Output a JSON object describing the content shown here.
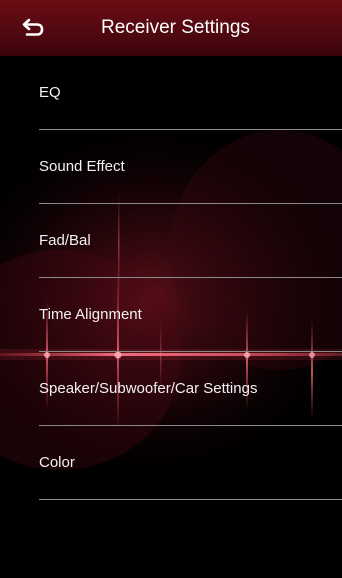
{
  "header": {
    "title": "Receiver Settings",
    "back_icon": "back-return-icon"
  },
  "menu": {
    "items": [
      {
        "label": "EQ"
      },
      {
        "label": "Sound Effect"
      },
      {
        "label": "Fad/Bal"
      },
      {
        "label": "Time Alignment"
      },
      {
        "label": "Speaker/Subwoofer/Car Settings"
      },
      {
        "label": "Color"
      }
    ]
  },
  "colors": {
    "header_red": "#5a0a12",
    "accent_red": "#c0182c",
    "background": "#000000",
    "text": "#f2f2f2",
    "divider": "#8a8a8a"
  }
}
